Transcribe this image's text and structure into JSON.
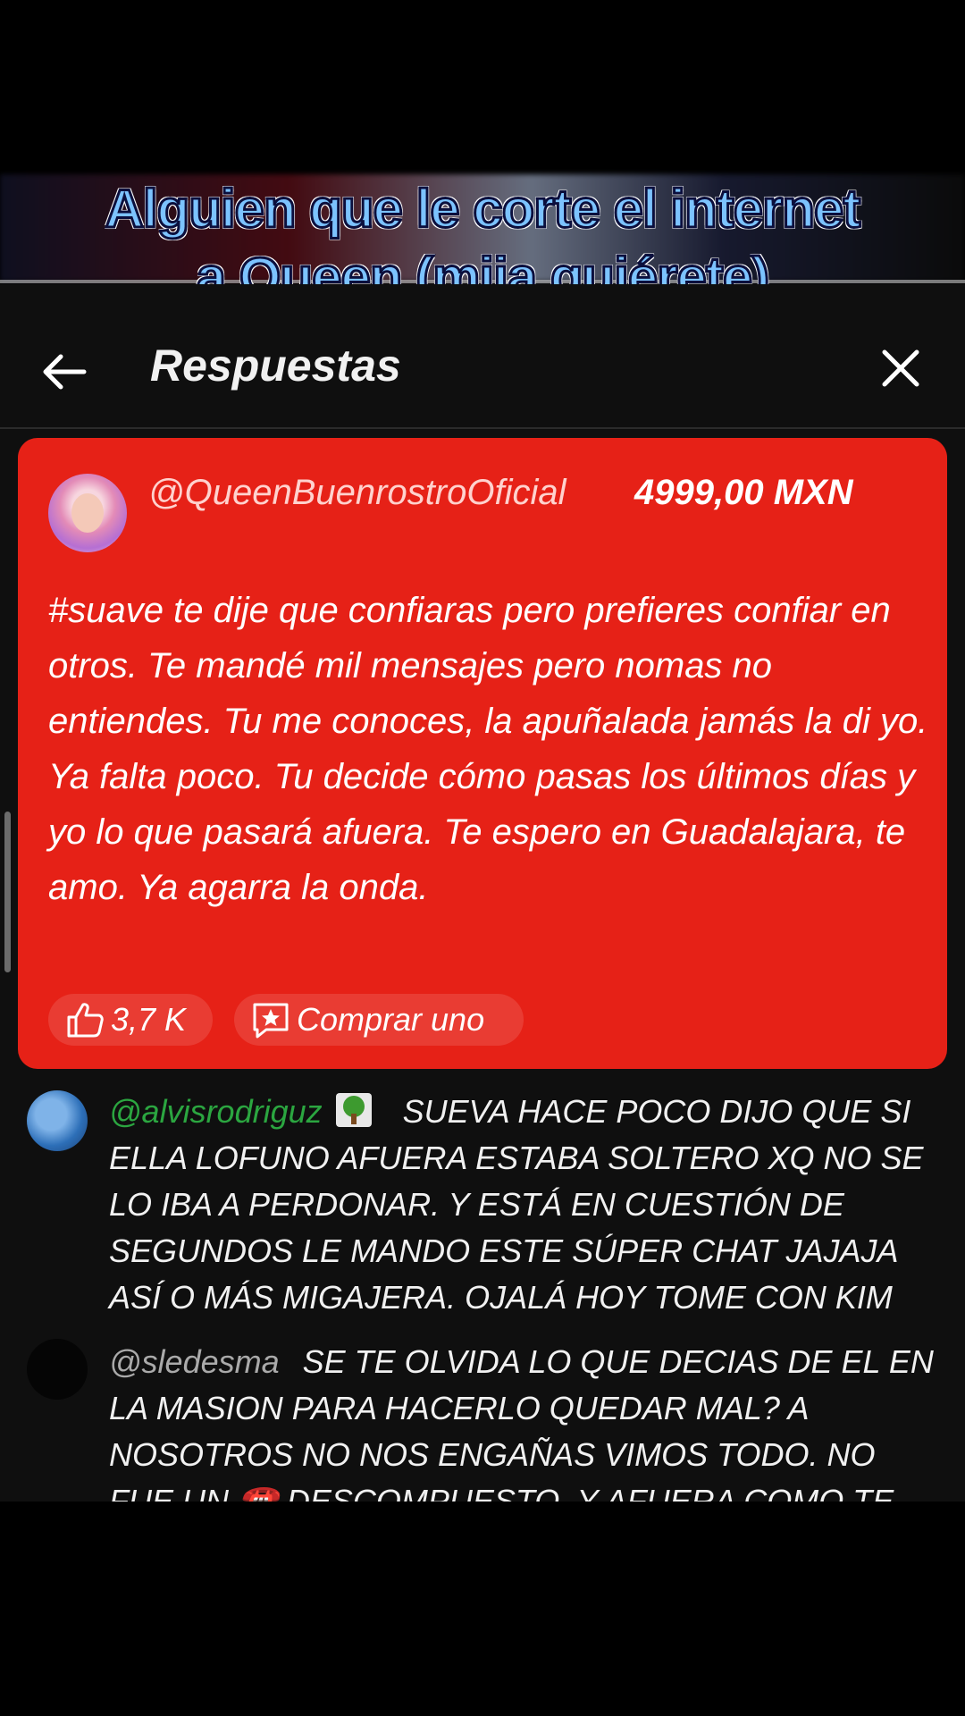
{
  "caption": {
    "line1": "Alguien que le corte el internet",
    "line2": "a Queen (mija quiérete)"
  },
  "header": {
    "title": "Respuestas"
  },
  "superchat": {
    "author": "@QueenBuenrostroOficial",
    "amount": "4999,00 MXN",
    "message": "#suave te dije que confiaras pero prefieres confiar en otros. Te mandé mil mensajes pero nomas no entiendes. Tu me conoces, la apuñalada jamás la di yo. Ya falta poco. Tu decide cómo pasas los últimos días y yo lo que pasará afuera. Te espero en Guadalajara, te amo. Ya agarra la onda.",
    "likes": "3,7 K",
    "buy_label": "Comprar uno"
  },
  "comments": [
    {
      "author": "@alvisrodriguz",
      "emoji": "tree-emoji",
      "text": "SUEVA HACE POCO DIJO QUE SI ELLA LOFUNO AFUERA ESTABA SOLTERO XQ NO SE LO IBA A PERDONAR. Y ESTÁ EN CUESTIÓN DE SEGUNDOS LE MANDO ESTE SÚPER CHAT JAJAJA ASÍ O MÁS MIGAJERA. OJALÁ HOY TOME CON KIM"
    },
    {
      "author": "@sledesma",
      "text": "SE TE OLVIDA LO QUE DECIAS DE EL EN LA MASION PARA HACERLO QUEDAR MAL? A NOSOTROS NO NOS ENGAÑAS VIMOS TODO. NO FUE UN ☎️ DESCOMPUESTO, Y AFUERA COMO TE"
    }
  ],
  "colors": {
    "superchat_bg": "#e62117",
    "caption_text": "#7cc3ff",
    "username_green": "#2ba640"
  }
}
